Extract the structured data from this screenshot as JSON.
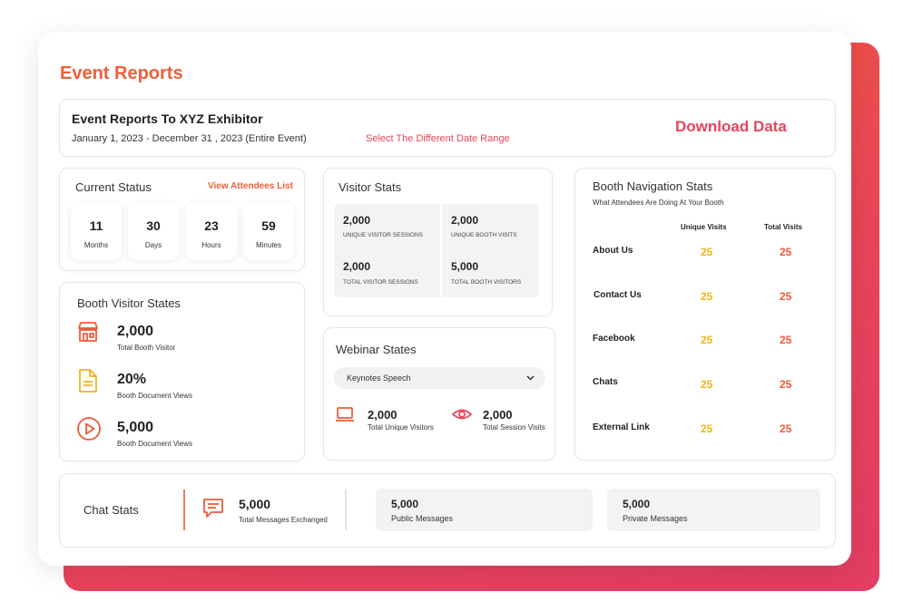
{
  "page": {
    "title": "Event Reports"
  },
  "header": {
    "heading": "Event Reports To XYZ Exhibitor",
    "date_range": "January 1, 2023 - December 31 , 2023 (Entire Event)",
    "select_range_link": "Select The Different Date Range",
    "download_button": "Download Data"
  },
  "current_status": {
    "title": "Current Status",
    "link": "View Attendees List",
    "tiles": [
      {
        "value": "11",
        "label": "Months"
      },
      {
        "value": "30",
        "label": "Days"
      },
      {
        "value": "23",
        "label": "Hours"
      },
      {
        "value": "59",
        "label": "Minutes"
      }
    ]
  },
  "booth_visitor": {
    "title": "Booth Visitor States",
    "items": [
      {
        "value": "2,000",
        "label": "Total Booth Visitor",
        "icon": "store-icon"
      },
      {
        "value": "20%",
        "label": "Booth Document Views",
        "icon": "document-icon"
      },
      {
        "value": "5,000",
        "label": "Booth Document Views",
        "icon": "play-icon"
      }
    ]
  },
  "visitor_stats": {
    "title": "Visitor Stats",
    "cells": [
      {
        "value": "2,000",
        "label": "UNIQUE VISITOR SESSIONS"
      },
      {
        "value": "2,000",
        "label": "UNIQUE BOOTH VISITS"
      },
      {
        "value": "2,000",
        "label": "TOTAL VISITOR SESSIONS"
      },
      {
        "value": "5,000",
        "label": "TOTAL BOOTH VISITORS"
      }
    ]
  },
  "webinar": {
    "title": "Webinar States",
    "select_value": "Keynotes Speech",
    "items": [
      {
        "value": "2,000",
        "label": "Total Unique Visitors",
        "icon": "laptop-icon"
      },
      {
        "value": "2,000",
        "label": "Total Session Visits",
        "icon": "eye-icon"
      }
    ]
  },
  "booth_nav": {
    "title": "Booth Navigation Stats",
    "subtitle": "What Attendees Are Doing At Your Booth",
    "col_unique": "Unique Visits",
    "col_total": "Total Visits",
    "rows": [
      {
        "label": "About Us",
        "unique": "25",
        "total": "25"
      },
      {
        "label": "Contact Us",
        "unique": "25",
        "total": "25"
      },
      {
        "label": "Facebook",
        "unique": "25",
        "total": "25"
      },
      {
        "label": "Chats",
        "unique": "25",
        "total": "25"
      },
      {
        "label": "External Link",
        "unique": "25",
        "total": "25"
      }
    ]
  },
  "chat": {
    "title": "Chat Stats",
    "main_value": "5,000",
    "main_label": "Total Messages Exchanged",
    "public_value": "5,000",
    "public_label": "Public Messages",
    "private_value": "5,000",
    "private_label": "Private Messages"
  },
  "colors": {
    "accent": "#ee5f3a",
    "pink": "#e8445a",
    "yellow": "#f2b418"
  }
}
